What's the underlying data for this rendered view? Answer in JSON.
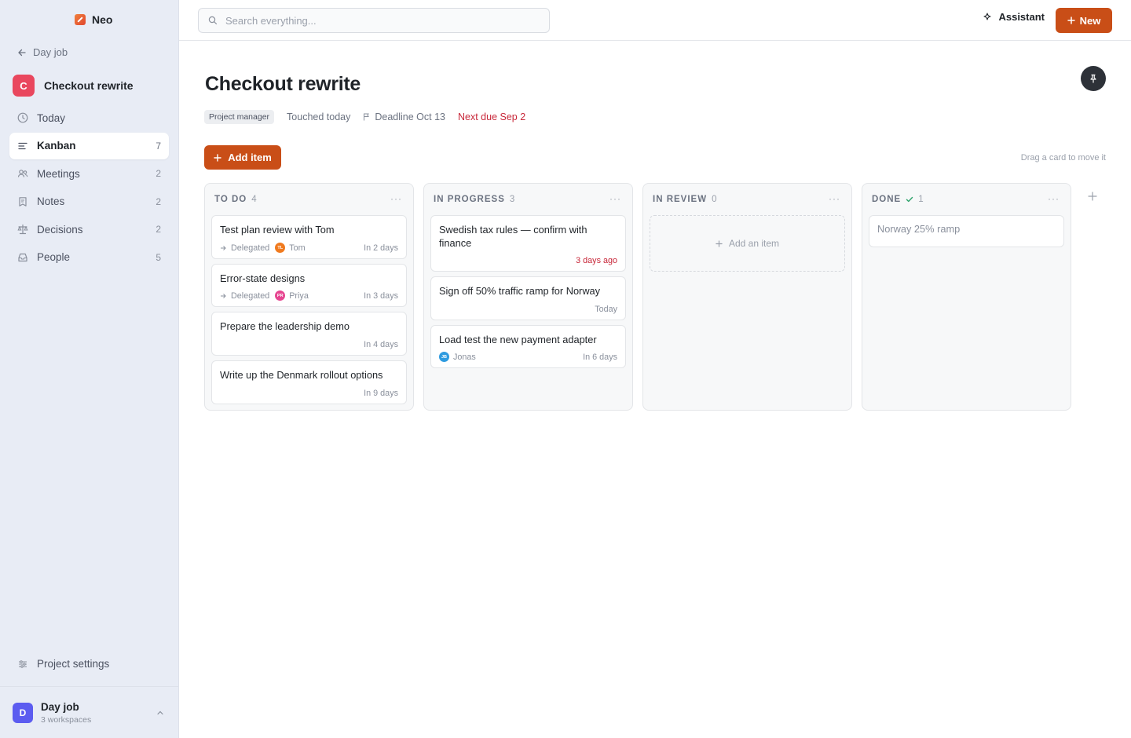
{
  "app": {
    "name": "Neo"
  },
  "sidebar": {
    "back_label": "Day job",
    "project": {
      "initial": "C",
      "name": "Checkout rewrite",
      "color": "#e9475e"
    },
    "items": [
      {
        "label": "Today",
        "count": "",
        "icon": "clock-icon"
      },
      {
        "label": "Kanban",
        "count": "7",
        "icon": "kanban-icon"
      },
      {
        "label": "Meetings",
        "count": "2",
        "icon": "people-icon"
      },
      {
        "label": "Notes",
        "count": "2",
        "icon": "note-icon"
      },
      {
        "label": "Decisions",
        "count": "2",
        "icon": "scale-icon"
      },
      {
        "label": "People",
        "count": "5",
        "icon": "inbox-icon"
      }
    ],
    "settings_label": "Project settings",
    "workspace": {
      "initial": "D",
      "name": "Day job",
      "sub": "3 workspaces",
      "color": "#5c5cf0"
    }
  },
  "topbar": {
    "search_placeholder": "Search everything...",
    "assistant_label": "Assistant",
    "new_label": "New"
  },
  "page": {
    "title": "Checkout rewrite",
    "role": "Project manager",
    "touched": "Touched today",
    "deadline": "Deadline Oct 13",
    "next_due": "Next due Sep 2",
    "add_item_label": "Add item",
    "hint": "Drag a card to move it"
  },
  "columns": [
    {
      "title": "TO DO",
      "count": "4",
      "cards": [
        {
          "title": "Test plan review with Tom",
          "delegated": "Delegated",
          "person": "Tom",
          "initials": "TL",
          "avatar_color": "#f07a1e",
          "due": "In 2 days"
        },
        {
          "title": "Error-state designs",
          "delegated": "Delegated",
          "person": "Priya",
          "initials": "PR",
          "avatar_color": "#e64590",
          "due": "In 3 days"
        },
        {
          "title": "Prepare the leadership demo",
          "due": "In 4 days"
        },
        {
          "title": "Write up the Denmark rollout options",
          "due": "In 9 days"
        }
      ]
    },
    {
      "title": "IN PROGRESS",
      "count": "3",
      "cards": [
        {
          "title": "Swedish tax rules — confirm with finance",
          "due": "3 days ago"
        },
        {
          "title": "Sign off 50% traffic ramp for Norway",
          "due": "Today"
        },
        {
          "title": "Load test the new payment adapter",
          "person": "Jonas",
          "initials": "JB",
          "avatar_color": "#2e9be0",
          "due": "In 6 days"
        }
      ]
    },
    {
      "title": "IN REVIEW",
      "count": "0",
      "add_label": "Add an item"
    },
    {
      "title": "DONE",
      "count": "1",
      "cards": [
        {
          "title": "Norway 25% ramp"
        }
      ]
    }
  ],
  "colors": {
    "accent": "#c94e17",
    "overdue": "#c8283a",
    "sidebar_bg": "#e8ecf5"
  }
}
